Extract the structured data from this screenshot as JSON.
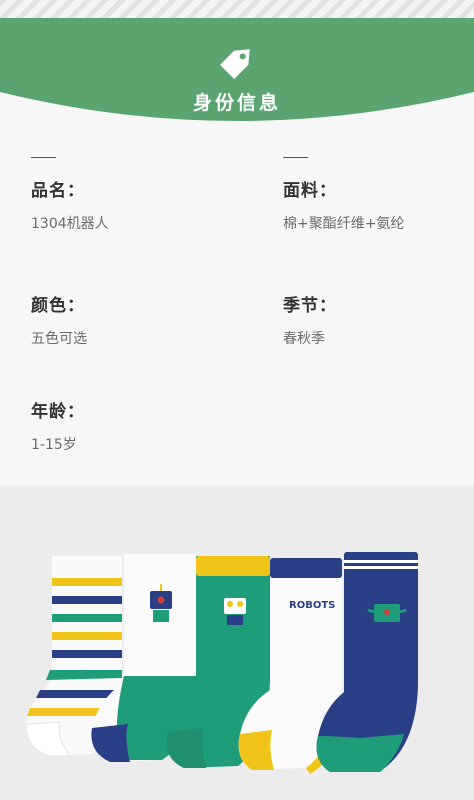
{
  "header": {
    "title": "身份信息",
    "icon": "price-tag-icon",
    "colors": {
      "green": "#5aa56f",
      "stripe": "#e6e6e6"
    }
  },
  "info": {
    "fields": [
      {
        "label": "品名：",
        "value": "1304机器人"
      },
      {
        "label": "面料：",
        "value": "棉+聚酯纤维+氨纶"
      },
      {
        "label": "颜色：",
        "value": "五色可选"
      },
      {
        "label": "季节：",
        "value": "春秋季"
      },
      {
        "label": "年龄：",
        "value": "1-15岁"
      }
    ]
  },
  "photo": {
    "sock_colors": [
      "#1f9c7a",
      "#f0c419",
      "#2a3f86",
      "#ffffff"
    ],
    "sock_text": "ROBOTS"
  }
}
